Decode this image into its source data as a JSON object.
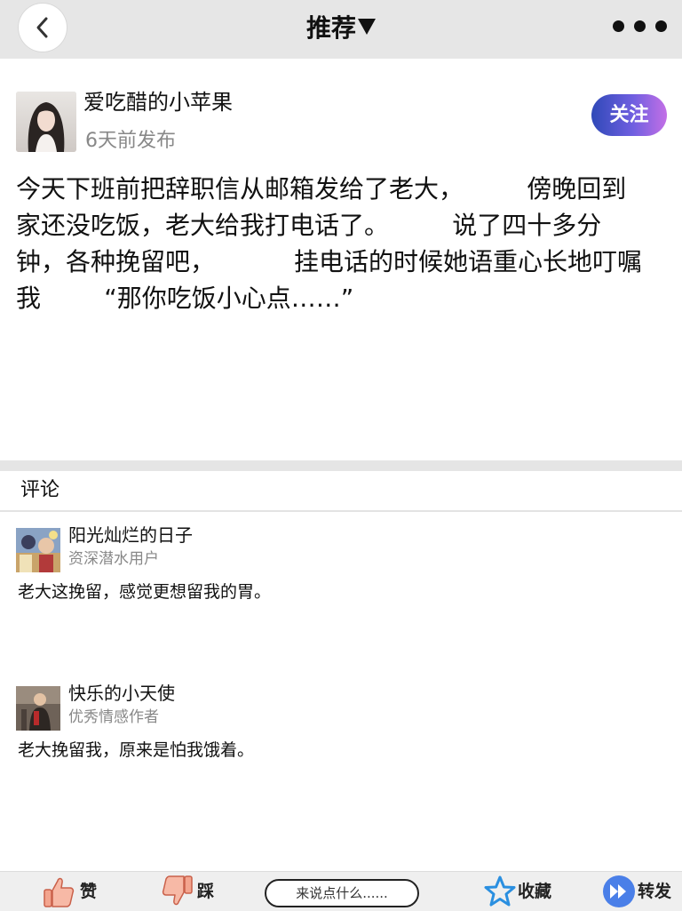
{
  "header": {
    "title": "推荐",
    "icons": {
      "back": "chevron-left-icon",
      "dropdown": "caret-down-icon",
      "more": "more-dots-icon"
    }
  },
  "post": {
    "author": "爱吃醋的小苹果",
    "time": "6天前发布",
    "follow_label": "关注",
    "lines": [
      "今天下班前把辞职信从邮箱发给了老大，        傍晚回到",
      "家还没吃饭，老大给我打电话了。        说了四十多分",
      "钟，各种挽留吧，          挂电话的时候她语重心长地叮嘱",
      "我        “那你吃饭小心点……”"
    ]
  },
  "comments": {
    "title": "评论",
    "items": [
      {
        "name": "阳光灿烂的日子",
        "badge": "资深潜水用户",
        "text": "老大这挽留，感觉更想留我的胃。"
      },
      {
        "name": "快乐的小天使",
        "badge": "优秀情感作者",
        "text": "老大挽留我，原来是怕我饿着。"
      }
    ]
  },
  "bottom_bar": {
    "like_label": "赞",
    "dislike_label": "踩",
    "comment_placeholder": "来说点什么......",
    "favorite_label": "收藏",
    "share_label": "转发",
    "icons": {
      "like": "thumbs-up-icon",
      "dislike": "thumbs-down-icon",
      "favorite": "star-icon",
      "share": "forward-icon"
    }
  },
  "colors": {
    "topbar_bg": "#e6e6e6",
    "follow_gradient_start": "#2f49b8",
    "follow_gradient_end": "#c36fe6",
    "secondary_text": "#888888",
    "like_icon": "#f0a088",
    "favorite_icon": "#2a8fe0",
    "share_icon": "#4a7fe8"
  }
}
